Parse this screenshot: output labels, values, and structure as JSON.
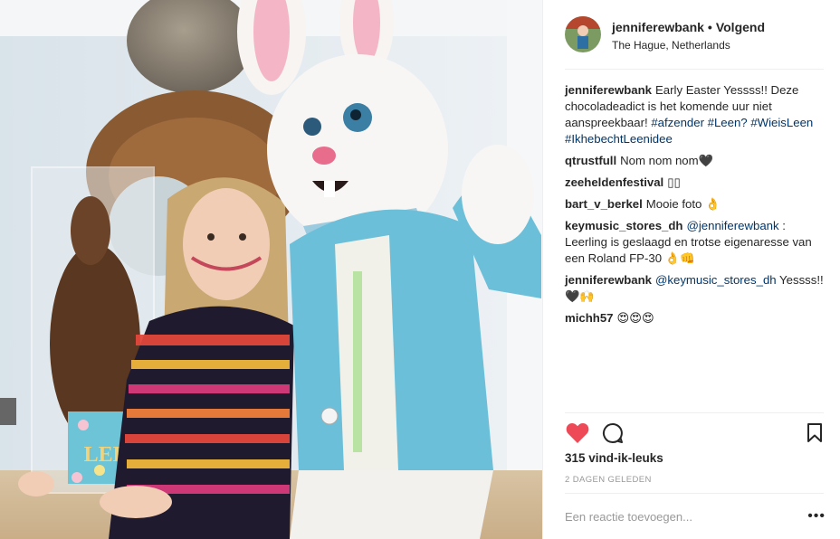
{
  "post": {
    "username": "jenniferewbank",
    "follow_label": "Volgend",
    "location": "The Hague, Netherlands",
    "likes": "315 vind-ik-leuks",
    "timestamp": "2 DAGEN GELEDEN",
    "comment_placeholder": "Een reactie toevoegen...",
    "more_label": "•••",
    "heart_color": "#ed4956"
  },
  "photo": {
    "alt": "Vrouw met chocolade paashaas naast persoon in paashazenkostuum",
    "box_label": "LEEM"
  },
  "comments": [
    {
      "user": "jenniferewbank",
      "parts": [
        {
          "t": "Early Easter Yessss!! Deze chocoladeadict is het komende uur niet aanspreekbaar! ",
          "tag": false
        },
        {
          "t": "#afzender",
          "tag": true
        },
        {
          "t": " ",
          "tag": false
        },
        {
          "t": "#Leen?",
          "tag": true
        },
        {
          "t": " ",
          "tag": false
        },
        {
          "t": "#WieisLeen",
          "tag": true
        },
        {
          "t": " ",
          "tag": false
        },
        {
          "t": "#IkhebechtLeenidee",
          "tag": true
        }
      ]
    },
    {
      "user": "qtrustfull",
      "parts": [
        {
          "t": "Nom nom nom🖤",
          "tag": false
        }
      ]
    },
    {
      "user": "zeeheldenfestival",
      "parts": [
        {
          "t": "▯▯",
          "tag": false
        }
      ]
    },
    {
      "user": "bart_v_berkel",
      "parts": [
        {
          "t": "Mooie foto 👌",
          "tag": false
        }
      ]
    },
    {
      "user": "keymusic_stores_dh",
      "parts": [
        {
          "t": "@jenniferewbank",
          "tag": true
        },
        {
          "t": " : Leerling is geslaagd en trotse eigenaresse van een Roland FP-30 👌👊",
          "tag": false
        }
      ]
    },
    {
      "user": "jenniferewbank",
      "parts": [
        {
          "t": "@keymusic_stores_dh",
          "tag": true
        },
        {
          "t": " Yessss!! 🖤🙌",
          "tag": false
        }
      ]
    },
    {
      "user": "michh57",
      "parts": [
        {
          "t": "😍😍😍",
          "tag": false
        }
      ]
    }
  ]
}
